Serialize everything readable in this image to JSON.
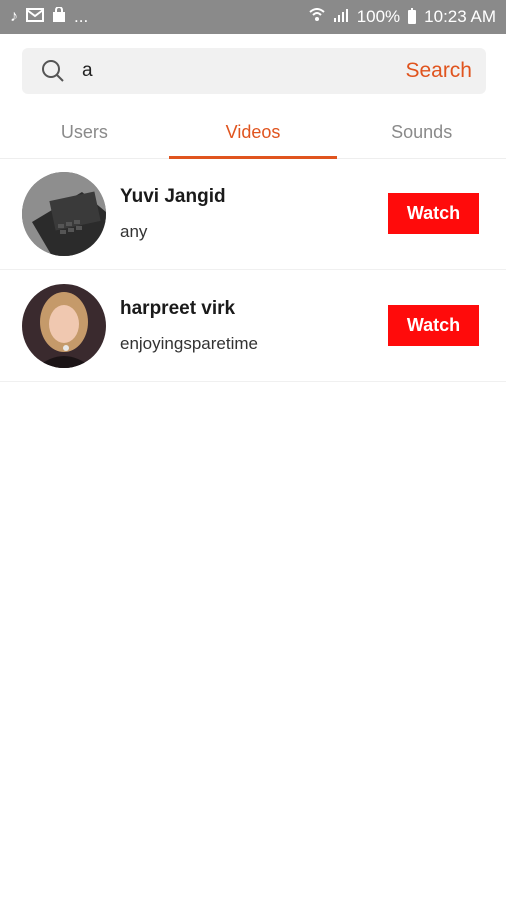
{
  "status_bar": {
    "time": "10:23 AM",
    "battery": "100%",
    "dots": "...",
    "icons_left": [
      "tiktok-icon",
      "mail-icon",
      "shopping-bag-icon"
    ],
    "icons_right": [
      "wifi-icon",
      "signal-icon",
      "battery-icon"
    ]
  },
  "search": {
    "value": "a",
    "submit_label": "Search"
  },
  "tabs": [
    {
      "label": "Users",
      "active": false
    },
    {
      "label": "Videos",
      "active": true
    },
    {
      "label": "Sounds",
      "active": false
    }
  ],
  "results": [
    {
      "name": "Yuvi Jangid",
      "subtitle": "any",
      "button": "Watch"
    },
    {
      "name": "harpreet virk",
      "subtitle": "enjoyingsparetime",
      "button": "Watch"
    }
  ],
  "colors": {
    "accent": "#e0541e",
    "watch_button": "#ff0b0b",
    "status_bar": "#8a8a8a"
  }
}
